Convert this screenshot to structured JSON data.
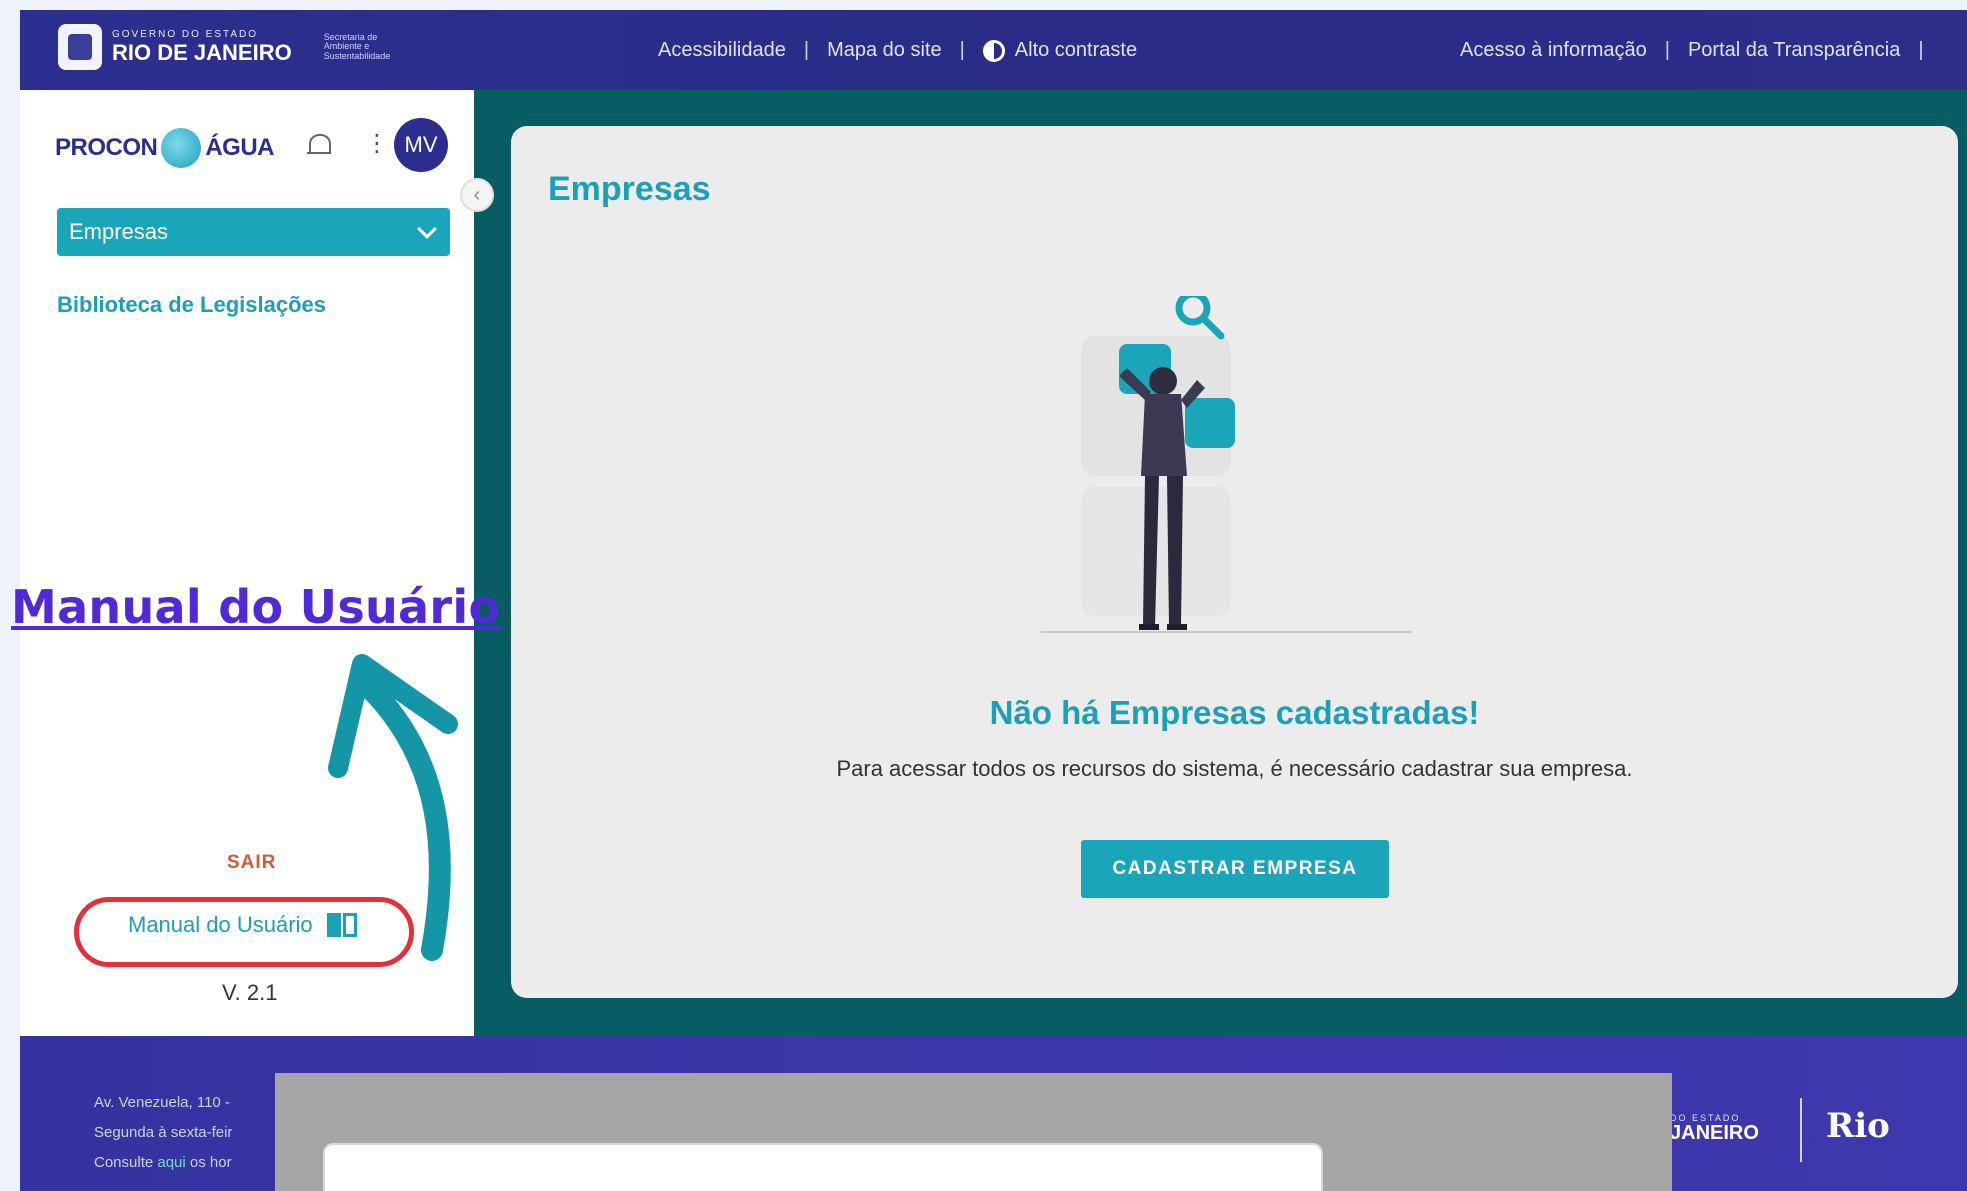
{
  "header": {
    "gov_small": "GOVERNO DO ESTADO",
    "gov_big": "RIO DE JANEIRO",
    "secretaria": "Secretaria de Ambiente e Sustentabilidade",
    "links_center": [
      "Acessibilidade",
      "Mapa do site",
      "Alto contraste"
    ],
    "links_right": [
      "Acesso à informação",
      "Portal da Transparência"
    ]
  },
  "sidebar": {
    "brand_left": "PROCON",
    "brand_right": "ÁGUA",
    "avatar_initials": "MV",
    "menu": {
      "active_label": "Empresas",
      "link_label": "Biblioteca de Legislações"
    },
    "logout_label": "SAIR",
    "manual_label": "Manual do Usuário",
    "version": "V. 2.1"
  },
  "main": {
    "title": "Empresas",
    "empty_title": "Não há Empresas cadastradas!",
    "empty_text": "Para acessar todos os recursos do sistema, é necessário cadastrar sua empresa.",
    "cta_label": "CADASTRAR EMPRESA"
  },
  "footer": {
    "line1": "Av. Venezuela, 110 -",
    "line2": "Segunda à sexta-feir",
    "line3_prefix": "Consulte",
    "line3_link": "aqui",
    "line3_suffix": "os hor",
    "logo_small": "DO ESTADO",
    "logo_big": "JANEIRO",
    "rio_logo": "Rio"
  },
  "annotation": {
    "overlay_link": "Manual do Usuário",
    "arrow_color": "#1596a6",
    "circle_color": "#e3303a"
  },
  "colors": {
    "topbar": "#2c2f8f",
    "teal": "#1aa6b8",
    "main_bg": "#075d61",
    "card_bg": "#ececec",
    "logout": "#cf5a3c"
  }
}
